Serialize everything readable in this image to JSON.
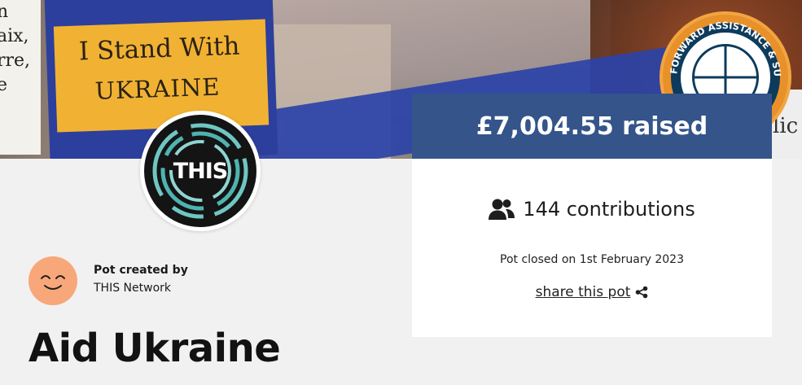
{
  "hero": {
    "sign_line1": "I Stand With",
    "sign_line2": "UKRAINE",
    "left_sign_text": [
      "n",
      "aix,",
      "rre,",
      "e"
    ],
    "right_sign_text": "lic"
  },
  "org": {
    "logo_text": "THIS",
    "seal_text": "FORWARD ASSISTANCE & SUPPORT TEAM"
  },
  "stats": {
    "raised": "£7,004.55 raised",
    "contributions": "144 contributions",
    "closed": "Pot closed on 1st February 2023",
    "share_label": "share this pot"
  },
  "creator": {
    "label": "Pot created by",
    "name": "THIS Network"
  },
  "pot": {
    "title": "Aid Ukraine"
  },
  "colors": {
    "raised_bar": "#34548a",
    "page_bg": "#f1f1f1",
    "avatar": "#f8a77a"
  }
}
